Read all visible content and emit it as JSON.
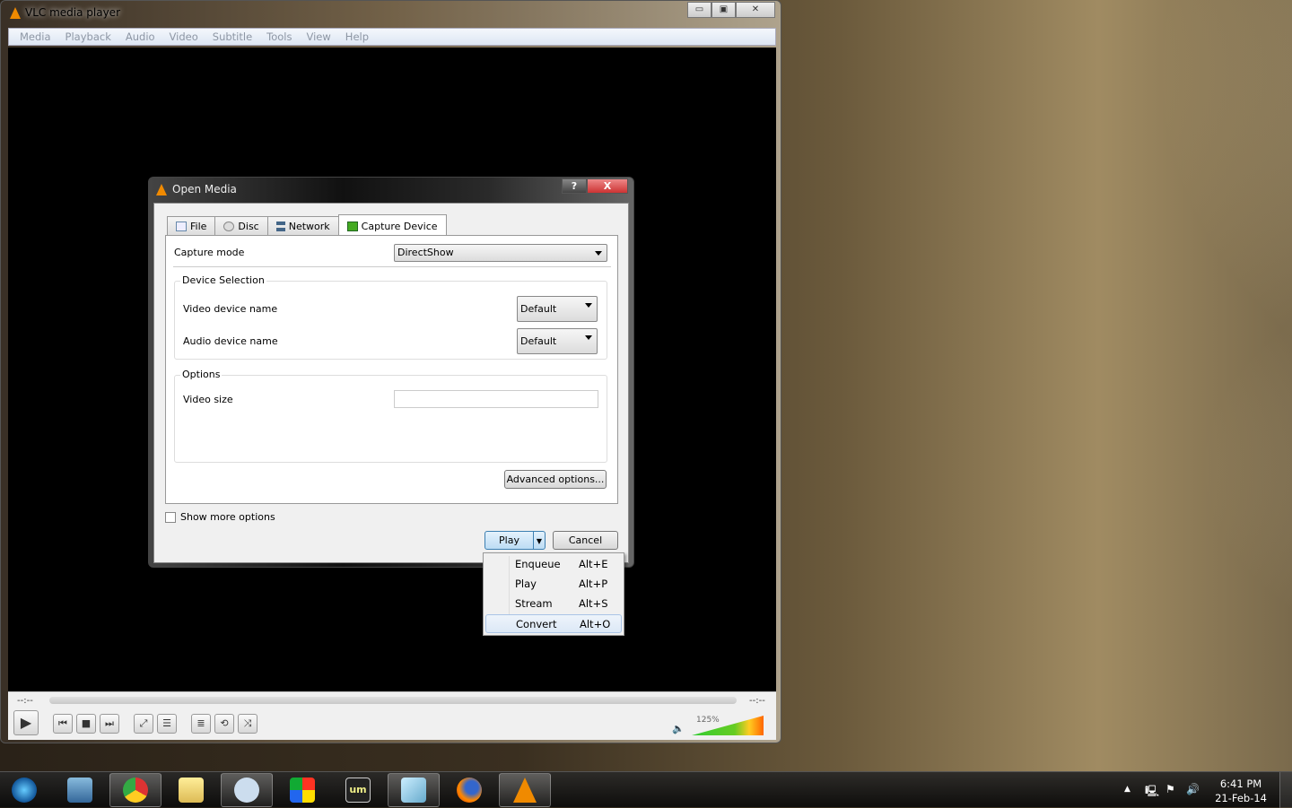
{
  "vlc": {
    "title": "VLC media player",
    "menu": [
      "Media",
      "Playback",
      "Audio",
      "Video",
      "Subtitle",
      "Tools",
      "View",
      "Help"
    ],
    "time_elapsed": "--:--",
    "time_total": "--:--",
    "volume_label": "125%",
    "volume_percent": 125,
    "controls": [
      "play",
      "previous",
      "stop",
      "next",
      "fullscreen",
      "extended-settings",
      "playlist",
      "loop",
      "random"
    ]
  },
  "dialog": {
    "title": "Open Media",
    "help_btn": "?",
    "close_btn": "X",
    "tabs": [
      {
        "label": "File",
        "icon": "file-icon"
      },
      {
        "label": "Disc",
        "icon": "disc-icon"
      },
      {
        "label": "Network",
        "icon": "network-icon"
      },
      {
        "label": "Capture Device",
        "icon": "capture-icon",
        "active": true
      }
    ],
    "capture_mode_label": "Capture mode",
    "capture_mode_value": "DirectShow",
    "device_selection": "Device Selection",
    "video_device_label": "Video device name",
    "video_device_value": "Default",
    "audio_device_label": "Audio device name",
    "audio_device_value": "Default",
    "options": "Options",
    "video_size_label": "Video size",
    "video_size_value": "",
    "advanced_btn": "Advanced options...",
    "show_more": "Show more options",
    "show_more_checked": false,
    "play_btn": "Play",
    "cancel_btn": "Cancel"
  },
  "play_menu": [
    {
      "label": "Enqueue",
      "shortcut": "Alt+E"
    },
    {
      "label": "Play",
      "shortcut": "Alt+P"
    },
    {
      "label": "Stream",
      "shortcut": "Alt+S"
    },
    {
      "label": "Convert",
      "shortcut": "Alt+O",
      "highlighted": true
    }
  ],
  "taskbar": {
    "apps": [
      "start",
      "windows-media-player",
      "chrome",
      "explorer",
      "paint",
      "app-grid",
      "ultramixer",
      "notepad",
      "firefox",
      "vlc"
    ],
    "time": "6:41 PM",
    "date": "21-Feb-14"
  }
}
